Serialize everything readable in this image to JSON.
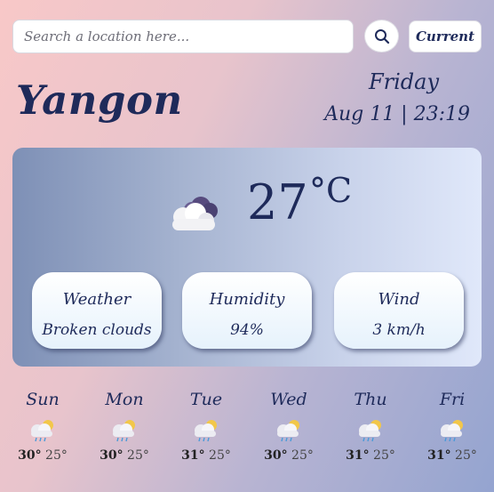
{
  "search": {
    "placeholder": "Search a location here...",
    "current_label": "Current"
  },
  "location": {
    "city": "Yangon",
    "day": "Friday",
    "datetime": "Aug 11 | 23:19"
  },
  "current": {
    "temperature": "27",
    "unit": "°C",
    "icon": "cloud-icon",
    "cards": [
      {
        "title": "Weather",
        "value": "Broken clouds"
      },
      {
        "title": "Humidity",
        "value": "94%"
      },
      {
        "title": "Wind",
        "value": "3 km/h"
      }
    ]
  },
  "forecast": [
    {
      "day": "Sun",
      "max": "30°",
      "min": "25°",
      "icon": "rain-sun-icon"
    },
    {
      "day": "Mon",
      "max": "30°",
      "min": "25°",
      "icon": "rain-sun-icon"
    },
    {
      "day": "Tue",
      "max": "31°",
      "min": "25°",
      "icon": "rain-sun-icon"
    },
    {
      "day": "Wed",
      "max": "30°",
      "min": "25°",
      "icon": "rain-sun-icon"
    },
    {
      "day": "Thu",
      "max": "31°",
      "min": "25°",
      "icon": "rain-sun-icon"
    },
    {
      "day": "Fri",
      "max": "31°",
      "min": "25°",
      "icon": "rain-sun-icon"
    }
  ],
  "colors": {
    "text": "#1e2a5a",
    "card_bg": "#ffffff",
    "panel_start": "#7e90b6",
    "panel_end": "#e0e8fa"
  }
}
